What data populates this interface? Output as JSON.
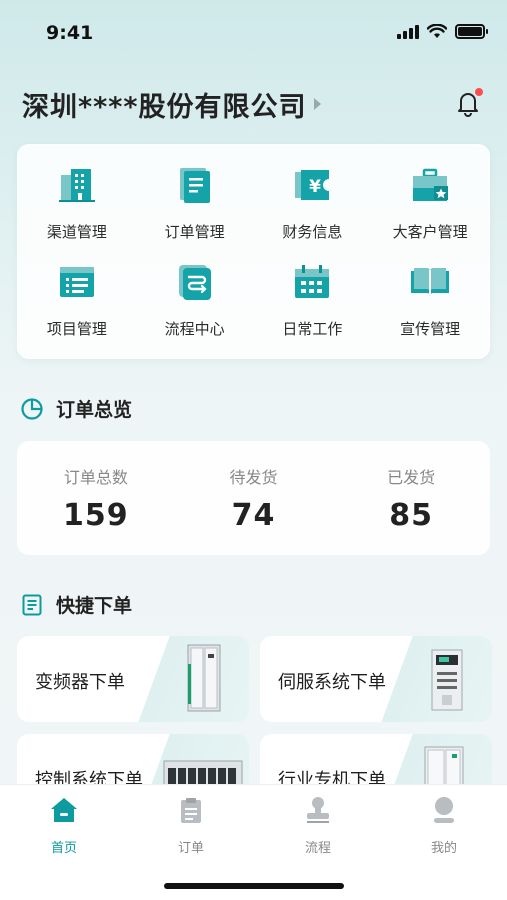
{
  "status_bar": {
    "time": "9:41"
  },
  "header": {
    "company_name": "深圳****股份有限公司"
  },
  "functions": [
    {
      "label": "渠道管理",
      "icon": "building-icon"
    },
    {
      "label": "订单管理",
      "icon": "clipboard-icon"
    },
    {
      "label": "财务信息",
      "icon": "yen-ticket-icon"
    },
    {
      "label": "大客户管理",
      "icon": "briefcase-star-icon"
    },
    {
      "label": "项目管理",
      "icon": "list-window-icon"
    },
    {
      "label": "流程中心",
      "icon": "flow-icon"
    },
    {
      "label": "日常工作",
      "icon": "calendar-icon"
    },
    {
      "label": "宣传管理",
      "icon": "book-icon"
    }
  ],
  "overview": {
    "title": "订单总览",
    "stats": [
      {
        "label": "订单总数",
        "value": "159"
      },
      {
        "label": "待发货",
        "value": "74"
      },
      {
        "label": "已发货",
        "value": "85"
      }
    ]
  },
  "quick_order": {
    "title": "快捷下单",
    "items": [
      {
        "label": "变频器下单"
      },
      {
        "label": "伺服系统下单"
      },
      {
        "label": "控制系统下单"
      },
      {
        "label": "行业专机下单"
      }
    ]
  },
  "tabbar": {
    "items": [
      {
        "label": "首页",
        "icon": "home-icon",
        "active": true
      },
      {
        "label": "订单",
        "icon": "order-icon",
        "active": false
      },
      {
        "label": "流程",
        "icon": "stamp-icon",
        "active": false
      },
      {
        "label": "我的",
        "icon": "user-icon",
        "active": false
      }
    ]
  },
  "colors": {
    "accent": "#0d9aa0",
    "badge": "#ff4d4f",
    "inactive": "#888888"
  }
}
